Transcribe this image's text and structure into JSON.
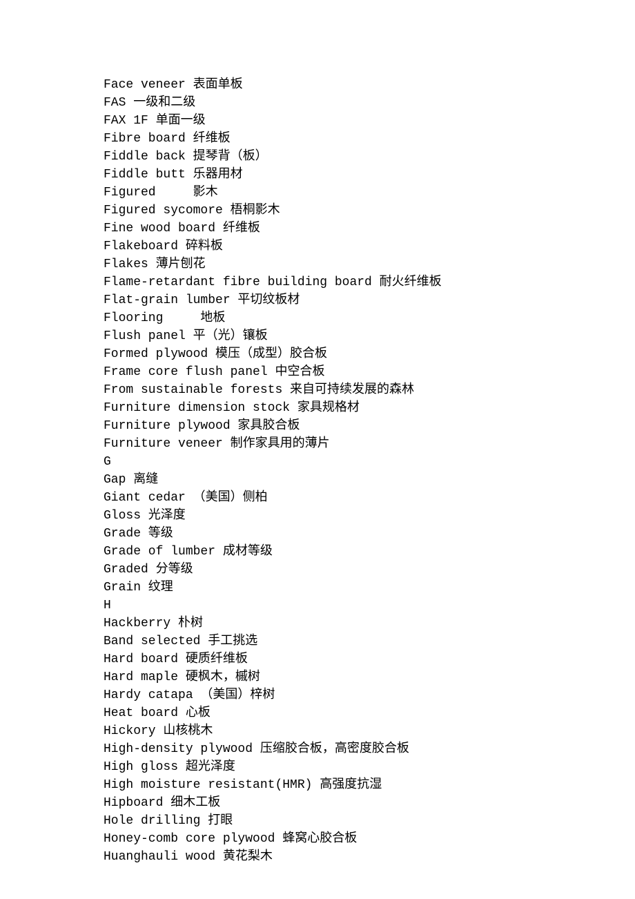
{
  "lines": [
    "Face veneer 表面单板",
    "FAS 一级和二级",
    "FAX 1F 单面一级",
    "Fibre board 纤维板",
    "Fiddle back 提琴背（板）",
    "Fiddle butt 乐器用材",
    "Figured     影木",
    "Figured sycomore 梧桐影木",
    "Fine wood board 纤维板",
    "Flakeboard 碎料板",
    "Flakes 薄片刨花",
    "Flame-retardant fibre building board 耐火纤维板",
    "Flat-grain lumber 平切纹板材",
    "Flooring     地板",
    "Flush panel 平（光）镶板",
    "Formed plywood 模压（成型）胶合板",
    "Frame core flush panel 中空合板",
    "From sustainable forests 来自可持续发展的森林",
    "Furniture dimension stock 家具规格材",
    "Furniture plywood 家具胶合板",
    "Furniture veneer 制作家具用的薄片",
    "G",
    "Gap 离缝",
    "Giant cedar （美国）侧柏",
    "Gloss 光泽度",
    "Grade 等级",
    "Grade of lumber 成材等级",
    "Graded 分等级",
    "Grain 纹理",
    "H",
    "Hackberry 朴树",
    "Band selected 手工挑选",
    "Hard board 硬质纤维板",
    "Hard maple 硬枫木，槭树",
    "Hardy catapa （美国）梓树",
    "Heat board 心板",
    "Hickory 山核桃木",
    "High-density plywood 压缩胶合板，高密度胶合板",
    "High gloss 超光泽度",
    "High moisture resistant(HMR) 高强度抗湿",
    "Hipboard 细木工板",
    "Hole drilling 打眼",
    "Honey-comb core plywood 蜂窝心胶合板",
    "Huanghauli wood 黄花梨木"
  ]
}
